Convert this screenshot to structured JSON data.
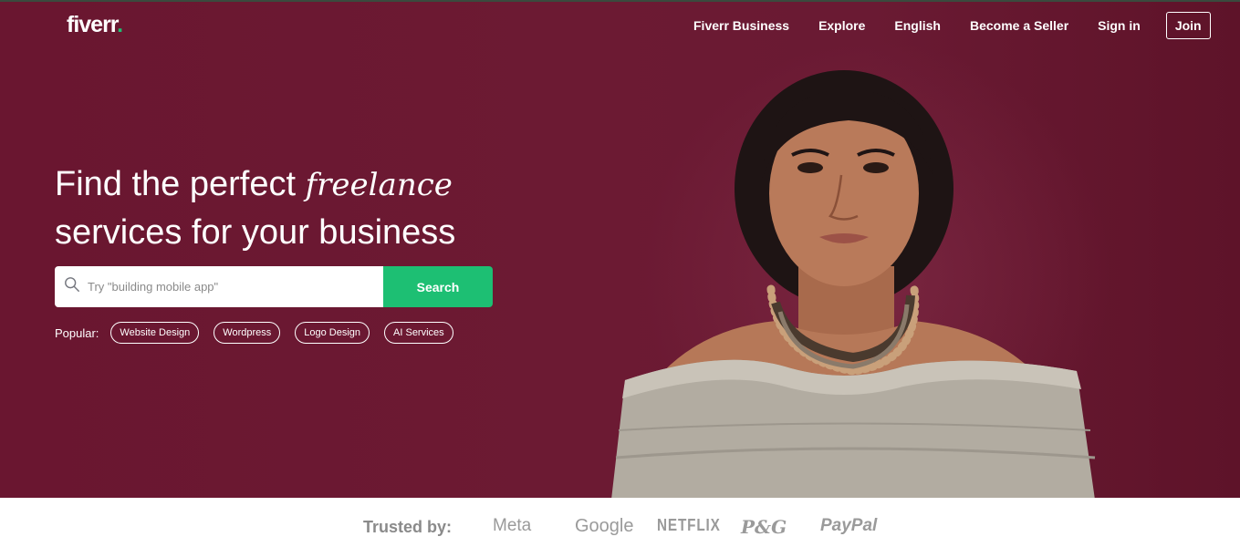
{
  "header": {
    "logo": "fiverr",
    "logo_dot": ".",
    "nav": [
      "Fiverr Business",
      "Explore",
      "English",
      "Become a Seller",
      "Sign in"
    ],
    "join": "Join"
  },
  "hero": {
    "headline_part1": "Find the perfect ",
    "headline_italic": "freelance",
    "headline_part2": "services for your business",
    "search": {
      "placeholder": "Try \"building mobile app\"",
      "button": "Search",
      "icon": "search-icon"
    },
    "popular": {
      "label": "Popular:",
      "tags": [
        "Website Design",
        "Wordpress",
        "Logo Design",
        "AI Services"
      ]
    }
  },
  "trusted": {
    "label": "Trusted by:",
    "brands": [
      "Meta",
      "Google",
      "NETFLIX",
      "P&G",
      "PayPal"
    ]
  },
  "colors": {
    "hero_bg": "#6a1630",
    "accent": "#1dbf73"
  }
}
